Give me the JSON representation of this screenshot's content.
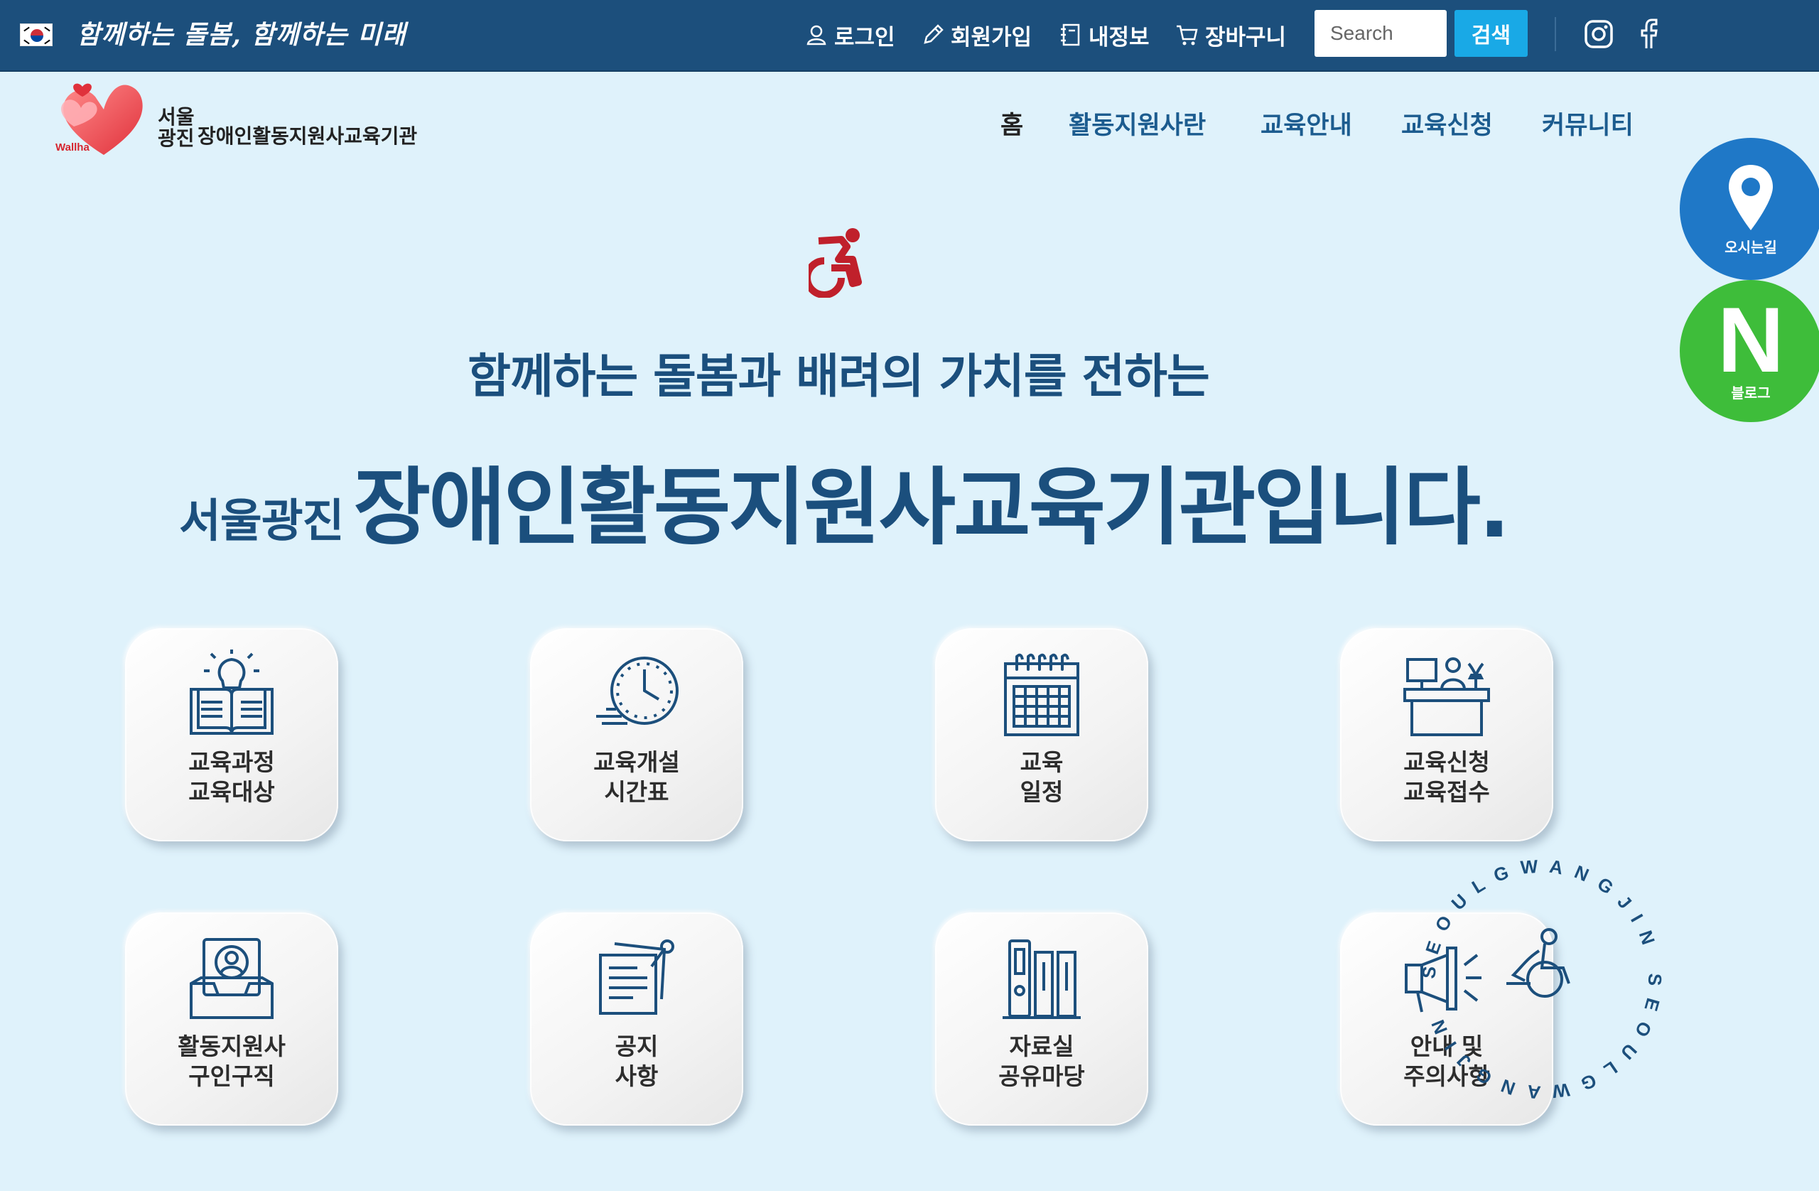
{
  "topbar": {
    "slogan": "함께하는 돌봄, 함께하는 미래",
    "links": {
      "login": "로그인",
      "signup": "회원가입",
      "myinfo": "내정보",
      "cart": "장바구니"
    },
    "search": {
      "placeholder": "Search",
      "button": "검색"
    }
  },
  "brand": {
    "city": "서울 광진",
    "name": "장애인활동지원사교육기관",
    "logo_text": "Wallha"
  },
  "nav": {
    "items": [
      "홈",
      "활동지원사란",
      "교육안내",
      "교육신청",
      "커뮤니티"
    ]
  },
  "floating": {
    "map_label": "오시는길",
    "blog_letter": "N",
    "blog_label": "블로그"
  },
  "hero": {
    "subtitle": "함께하는 돌봄과 배려의 가치를 전하는",
    "prefix": "서울광진",
    "title": "장애인활동지원사교육기관입니다."
  },
  "cards": [
    {
      "line1": "교육과정",
      "line2": "교육대상",
      "icon": "book-lightbulb-icon"
    },
    {
      "line1": "교육개설",
      "line2": "시간표",
      "icon": "clock-icon"
    },
    {
      "line1": "교육",
      "line2": "일정",
      "icon": "calendar-icon"
    },
    {
      "line1": "교육신청",
      "line2": "교육접수",
      "icon": "desk-icon"
    },
    {
      "line1": "활동지원사",
      "line2": "구인구직",
      "icon": "profile-inbox-icon"
    },
    {
      "line1": "공지",
      "line2": "사항",
      "icon": "notice-paper-icon"
    },
    {
      "line1": "자료실",
      "line2": "공유마당",
      "icon": "archive-binders-icon"
    },
    {
      "line1": "안내 및",
      "line2": "주의사항",
      "icon": "megaphone-icon"
    }
  ],
  "badge": {
    "text": "SEOULGWANGJIN SEOULGWANGJIN"
  },
  "colors": {
    "topbar": "#1c4f7c",
    "accent": "#19a9e6",
    "brand_text": "#1b4f7d",
    "background": "#dff2fb"
  }
}
